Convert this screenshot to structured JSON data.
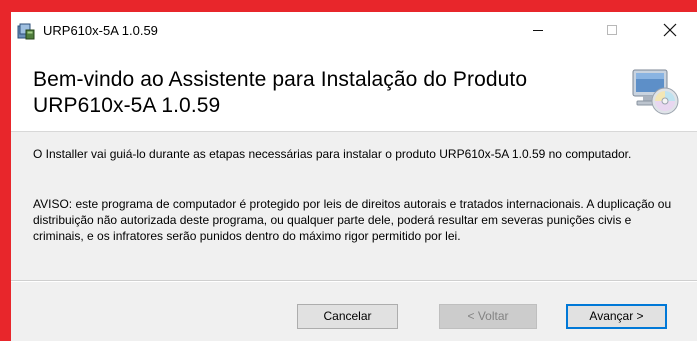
{
  "window": {
    "title": "URP610x-5A 1.0.59"
  },
  "title_controls": {
    "minimize": "minimize-icon",
    "maximize": "maximize-icon",
    "close": "close-icon"
  },
  "header": {
    "title": "Bem-vindo ao Assistente para Instalação do Produto URP610x-5A 1.0.59",
    "icon": "computer-cd-icon"
  },
  "content": {
    "paragraph1": "O Installer vai guiá-lo durante as etapas necessárias para instalar o produto URP610x-5A 1.0.59 no computador.",
    "paragraph2": "AVISO: este programa de computador é protegido por leis de direitos autorais e tratados internacionais. A duplicação ou distribuição não autorizada deste programa, ou qualquer parte dele, poderá resultar em severas punições civis e criminais, e os infratores serão punidos dentro do máximo rigor permitido por lei."
  },
  "buttons": {
    "cancel": "Cancelar",
    "back": "< Voltar",
    "next": "Avançar >"
  },
  "colors": {
    "outer_border": "#e8262b",
    "dialog_bg": "#f0f0f0",
    "default_button_border": "#0078d7"
  }
}
